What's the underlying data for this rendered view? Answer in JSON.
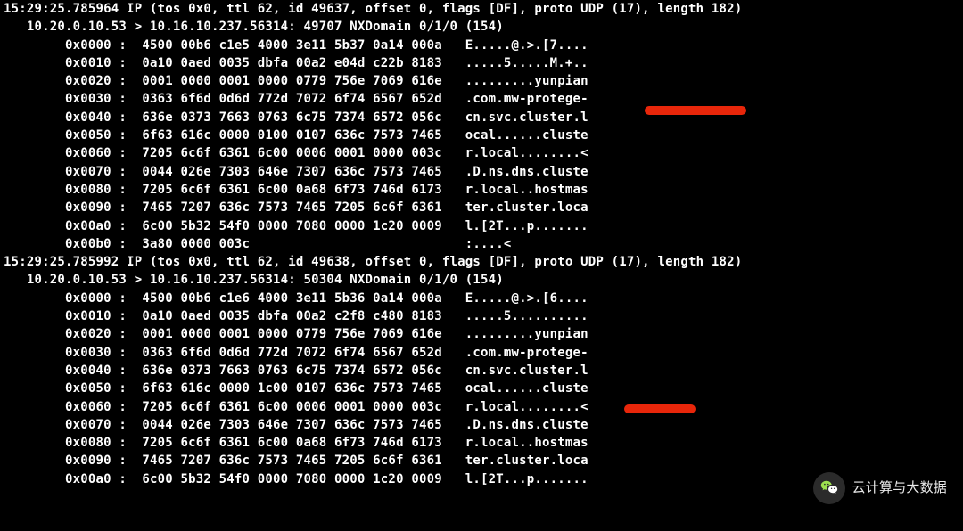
{
  "packets": [
    {
      "header": "15:29:25.785964 IP (tos 0x0, ttl 62, id 49637, offset 0, flags [DF], proto UDP (17), length 182)",
      "subheader": "   10.20.0.10.53 > 10.16.10.237.56314: 49707 NXDomain 0/1/0 (154)",
      "rows": [
        {
          "off": "0x0000",
          "hex": "4500 00b6 c1e5 4000 3e11 5b37 0a14 000a",
          "ascii": "E.....@.>.[7...."
        },
        {
          "off": "0x0010",
          "hex": "0a10 0aed 0035 dbfa 00a2 e04d c22b 8183",
          "ascii": ".....5.....M.+.."
        },
        {
          "off": "0x0020",
          "hex": "0001 0000 0001 0000 0779 756e 7069 616e",
          "ascii": ".........yunpian"
        },
        {
          "off": "0x0030",
          "hex": "0363 6f6d 0d6d 772d 7072 6f74 6567 652d",
          "ascii": ".com.mw-protege-"
        },
        {
          "off": "0x0040",
          "hex": "636e 0373 7663 0763 6c75 7374 6572 056c",
          "ascii": "cn.svc.cluster.l"
        },
        {
          "off": "0x0050",
          "hex": "6f63 616c 0000 0100 0107 636c 7573 7465",
          "ascii": "ocal......cluste"
        },
        {
          "off": "0x0060",
          "hex": "7205 6c6f 6361 6c00 0006 0001 0000 003c",
          "ascii": "r.local........<"
        },
        {
          "off": "0x0070",
          "hex": "0044 026e 7303 646e 7307 636c 7573 7465",
          "ascii": ".D.ns.dns.cluste"
        },
        {
          "off": "0x0080",
          "hex": "7205 6c6f 6361 6c00 0a68 6f73 746d 6173",
          "ascii": "r.local..hostmas"
        },
        {
          "off": "0x0090",
          "hex": "7465 7207 636c 7573 7465 7205 6c6f 6361",
          "ascii": "ter.cluster.loca"
        },
        {
          "off": "0x00a0",
          "hex": "6c00 5b32 54f0 0000 7080 0000 1c20 0009",
          "ascii": "l.[2T...p......."
        },
        {
          "off": "0x00b0",
          "hex": "3a80 0000 003c                         ",
          "ascii": ":....<"
        }
      ]
    },
    {
      "header": "15:29:25.785992 IP (tos 0x0, ttl 62, id 49638, offset 0, flags [DF], proto UDP (17), length 182)",
      "subheader": "   10.20.0.10.53 > 10.16.10.237.56314: 50304 NXDomain 0/1/0 (154)",
      "rows": [
        {
          "off": "0x0000",
          "hex": "4500 00b6 c1e6 4000 3e11 5b36 0a14 000a",
          "ascii": "E.....@.>.[6...."
        },
        {
          "off": "0x0010",
          "hex": "0a10 0aed 0035 dbfa 00a2 c2f8 c480 8183",
          "ascii": ".....5.........."
        },
        {
          "off": "0x0020",
          "hex": "0001 0000 0001 0000 0779 756e 7069 616e",
          "ascii": ".........yunpian"
        },
        {
          "off": "0x0030",
          "hex": "0363 6f6d 0d6d 772d 7072 6f74 6567 652d",
          "ascii": ".com.mw-protege-"
        },
        {
          "off": "0x0040",
          "hex": "636e 0373 7663 0763 6c75 7374 6572 056c",
          "ascii": "cn.svc.cluster.l"
        },
        {
          "off": "0x0050",
          "hex": "6f63 616c 0000 1c00 0107 636c 7573 7465",
          "ascii": "ocal......cluste"
        },
        {
          "off": "0x0060",
          "hex": "7205 6c6f 6361 6c00 0006 0001 0000 003c",
          "ascii": "r.local........<"
        },
        {
          "off": "0x0070",
          "hex": "0044 026e 7303 646e 7307 636c 7573 7465",
          "ascii": ".D.ns.dns.cluste"
        },
        {
          "off": "0x0080",
          "hex": "7205 6c6f 6361 6c00 0a68 6f73 746d 6173",
          "ascii": "r.local..hostmas"
        },
        {
          "off": "0x0090",
          "hex": "7465 7207 636c 7573 7465 7205 6c6f 6361",
          "ascii": "ter.cluster.loca"
        },
        {
          "off": "0x00a0",
          "hex": "6c00 5b32 54f0 0000 7080 0000 1c20 0009",
          "ascii": "l.[2T...p......."
        }
      ]
    }
  ],
  "watermark": {
    "text": "云计算与大数据"
  }
}
